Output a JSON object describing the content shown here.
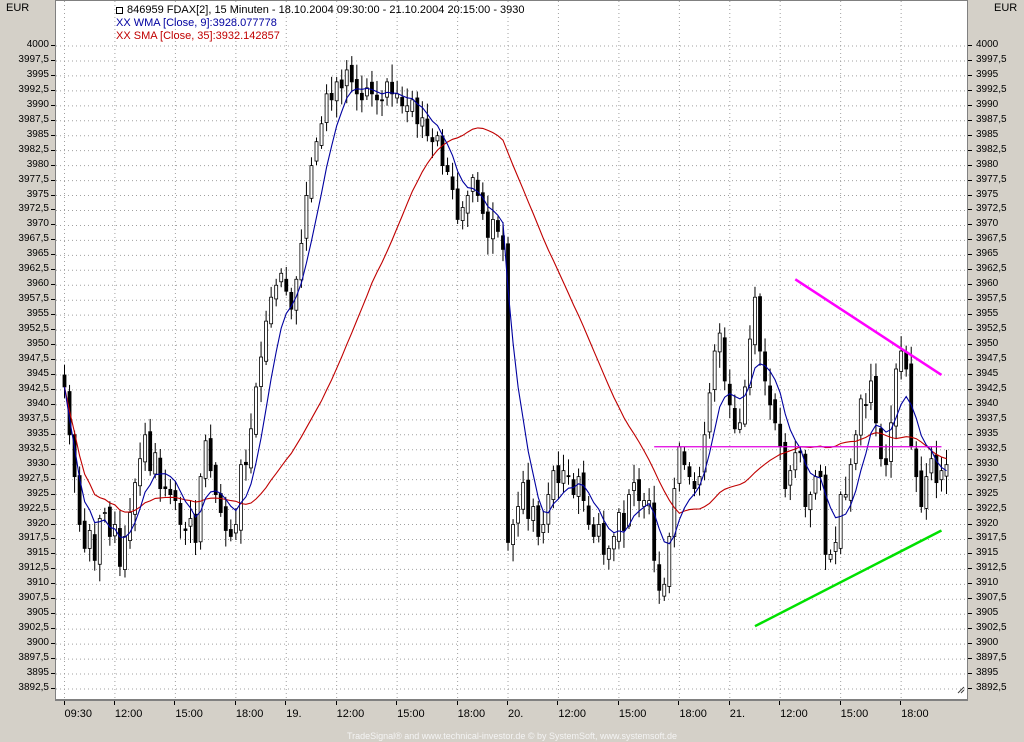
{
  "header": {
    "symbol_line": "846959  FDAX[2], 15 Minuten - 18.10.2004 09:30:00 - 21.10.2004 20:15:00 - 3930",
    "wma_label": "XX WMA [Close, 9]:3928.077778",
    "sma_label": "XX SMA [Close, 35]:3932.142857"
  },
  "axes": {
    "currency_left": "EUR",
    "currency_right": "EUR"
  },
  "footer": "TradeSignal® and www.technical-investor.de © by SystemSoft, www.systemsoft.de",
  "colors": {
    "wma": "#0000a0",
    "sma": "#c00000",
    "resistance": "#ff00ff",
    "support": "#00e000",
    "midline": "#e000e0",
    "candle": "#000000"
  },
  "chart_data": {
    "type": "candlestick",
    "ylim": [
      3891,
      4002
    ],
    "y_ticks": [
      "4000",
      "3997,5",
      "3995",
      "3992,5",
      "3990",
      "3987,5",
      "3985",
      "3982,5",
      "3980",
      "3977,5",
      "3975",
      "3972,5",
      "3970",
      "3967,5",
      "3965",
      "3962,5",
      "3960",
      "3957,5",
      "3955",
      "3952,5",
      "3950",
      "3947,5",
      "3945",
      "3942,5",
      "3940",
      "3937,5",
      "3935",
      "3932,5",
      "3930",
      "3927,5",
      "3925",
      "3922,5",
      "3920",
      "3917,5",
      "3915",
      "3912,5",
      "3910",
      "3907,5",
      "3905",
      "3902,5",
      "3900",
      "3897,5",
      "3895",
      "3892,5"
    ],
    "x_ticks": [
      "09:30",
      "12:00",
      "15:00",
      "18:00",
      "19.",
      "12:00",
      "15:00",
      "18:00",
      "20.",
      "12:00",
      "15:00",
      "18:00",
      "21.",
      "12:00",
      "15:00",
      "18:00"
    ],
    "bars_per_day": 44,
    "days": [
      "18.10.2004",
      "19.10.2004",
      "20.10.2004",
      "21.10.2004"
    ],
    "close": [
      3943,
      3935,
      3928,
      3920,
      3916,
      3919,
      3914,
      3921,
      3922,
      3918,
      3920,
      3913,
      3918,
      3922,
      3927,
      3931,
      3935,
      3929,
      3932,
      3926,
      3926,
      3925,
      3924,
      3920,
      3919,
      3921,
      3917,
      3928,
      3934,
      3929,
      3925,
      3922,
      3919,
      3918,
      3920,
      3930,
      3930,
      3936,
      3943,
      3948,
      3954,
      3958,
      3960,
      3962,
      3959,
      3956,
      3961,
      3967,
      3975,
      3980,
      3984,
      3987,
      3992,
      3991,
      3994,
      3993,
      3996,
      3994,
      3992,
      3991,
      3993,
      3992,
      3991,
      3991,
      3994,
      3992,
      3992,
      3990,
      3990,
      3991,
      3987,
      3988,
      3985,
      3984,
      3985,
      3980,
      3979,
      3976,
      3971,
      3973,
      3975,
      3978,
      3975,
      3972,
      3968,
      3971,
      3969,
      3966,
      3917,
      3920,
      3923,
      3927,
      3921,
      3923,
      3918,
      3920,
      3925,
      3929,
      3927,
      3929,
      3928,
      3925,
      3928,
      3924,
      3920,
      3918,
      3920,
      3915,
      3916,
      3918,
      3922,
      3919,
      3925,
      3927,
      3924,
      3924,
      3924,
      3914,
      3909,
      3910,
      3918,
      3926,
      3933,
      3930,
      3928,
      3926,
      3928,
      3935,
      3942,
      3949,
      3952,
      3944,
      3940,
      3936,
      3937,
      3943,
      3951,
      3958,
      3949,
      3944,
      3940,
      3937,
      3933,
      3926,
      3929,
      3932,
      3932,
      3923,
      3925,
      3928,
      3928,
      3915,
      3915,
      3917,
      3925,
      3925,
      3930,
      3935,
      3941,
      3940,
      3944,
      3937,
      3931,
      3930,
      3937,
      3946,
      3949,
      3946,
      3933,
      3928,
      3923,
      3928,
      3931,
      3927,
      3929,
      3930
    ],
    "series": [
      {
        "name": "XX WMA [Close, 9]"
      },
      {
        "name": "XX SMA [Close, 35]"
      }
    ],
    "trendlines": [
      {
        "x": [
          145,
          174
        ],
        "y": [
          3961,
          3945
        ]
      },
      {
        "x": [
          117,
          174
        ],
        "y": [
          3933,
          3933
        ]
      },
      {
        "x": [
          137,
          174
        ],
        "y": [
          3903,
          3919
        ]
      }
    ]
  }
}
